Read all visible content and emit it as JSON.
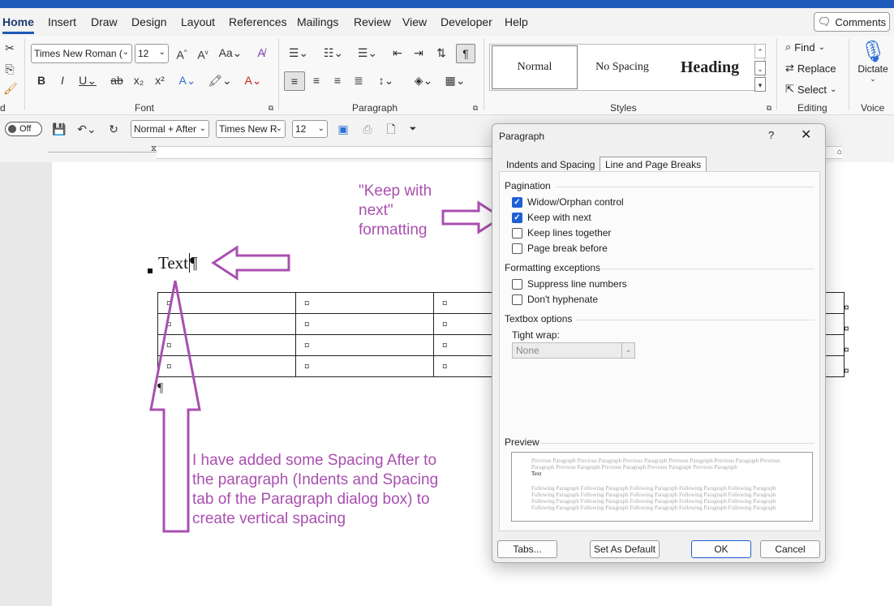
{
  "ribbon_tabs": [
    "Home",
    "Insert",
    "Draw",
    "Design",
    "Layout",
    "References",
    "Mailings",
    "Review",
    "View",
    "Developer",
    "Help"
  ],
  "comments_label": "Comments",
  "font": {
    "name": "Times New Roman (",
    "size": "12",
    "group_label": "Font"
  },
  "paragraph_group_label": "Paragraph",
  "styles": {
    "items": [
      "Normal",
      "No Spacing",
      "Heading"
    ],
    "group_label": "Styles"
  },
  "editing": {
    "find": "Find",
    "replace": "Replace",
    "select": "Select",
    "group_label": "Editing"
  },
  "voice": {
    "dictate": "Dictate",
    "group_label": "Voice"
  },
  "qat": {
    "autosave": "Off",
    "style_combo": "Normal + After",
    "font_combo": "Times New R",
    "size_combo": "12"
  },
  "document": {
    "text": "Text",
    "pilcrow": "¶",
    "cell_mark": "¤",
    "rows": 4,
    "cols": 3
  },
  "annotations": {
    "keep_with_next": "\"Keep with next\" formatting",
    "spacing_note": "I have added some Spacing After to the paragraph (Indents and Spacing tab of the Paragraph dialog box) to create vertical spacing",
    "color": "#a94fb0"
  },
  "dialog": {
    "title": "Paragraph",
    "help": "?",
    "tabs": [
      "Indents and Spacing",
      "Line and Page Breaks"
    ],
    "active_tab": "Line and Page Breaks",
    "pagination_label": "Pagination",
    "pagination": [
      {
        "label": "Widow/Orphan control",
        "checked": true
      },
      {
        "label": "Keep with next",
        "checked": true
      },
      {
        "label": "Keep lines together",
        "checked": false
      },
      {
        "label": "Page break before",
        "checked": false
      }
    ],
    "formatting_label": "Formatting exceptions",
    "formatting": [
      {
        "label": "Suppress line numbers",
        "checked": false
      },
      {
        "label": "Don't hyphenate",
        "checked": false
      }
    ],
    "textbox_label": "Textbox options",
    "tight_wrap_label": "Tight wrap:",
    "tight_wrap_value": "None",
    "preview_label": "Preview",
    "preview_prev": "Previous Paragraph Previous Paragraph Previous Paragraph Previous Paragraph Previous Paragraph Previous Paragraph Previous Paragraph Previous Paragraph Previous Paragraph Previous Paragraph",
    "preview_text": "Text",
    "preview_follow": "Following Paragraph Following Paragraph Following Paragraph Following Paragraph Following Paragraph Following Paragraph Following Paragraph Following Paragraph Following Paragraph Following Paragraph Following Paragraph Following Paragraph Following Paragraph Following Paragraph Following Paragraph Following Paragraph Following Paragraph Following Paragraph Following Paragraph Following Paragraph",
    "buttons": {
      "tabs": "Tabs...",
      "default": "Set As Default",
      "ok": "OK",
      "cancel": "Cancel"
    }
  }
}
